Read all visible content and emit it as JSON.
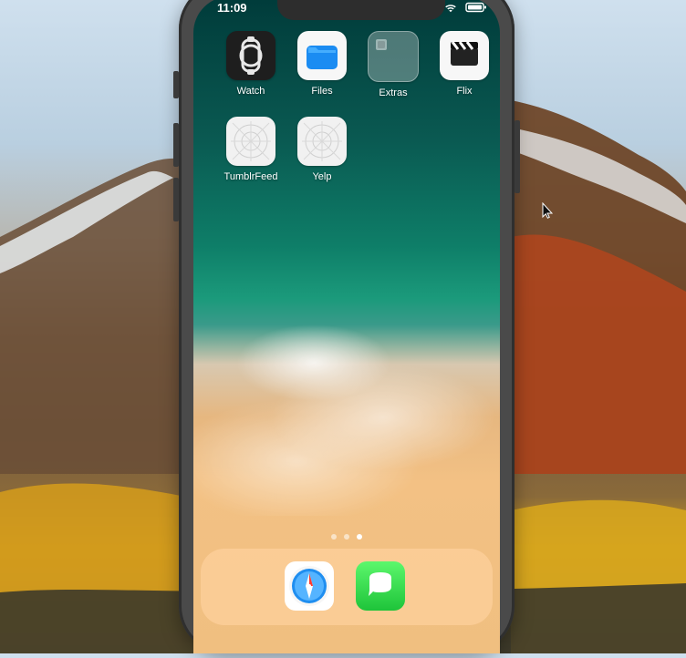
{
  "status_bar": {
    "time": "11:09",
    "icons": [
      "wifi-icon",
      "battery-icon"
    ]
  },
  "home_screen": {
    "apps": [
      {
        "label": "Watch",
        "icon": "watch-icon"
      },
      {
        "label": "Files",
        "icon": "files-icon"
      },
      {
        "label": "Extras",
        "icon": "folder-icon"
      },
      {
        "label": "Flix",
        "icon": "clapperboard-icon"
      },
      {
        "label": "TumblrFeed",
        "icon": "placeholder-app-icon"
      },
      {
        "label": "Yelp",
        "icon": "placeholder-app-icon"
      }
    ],
    "page_indicator": {
      "count": 3,
      "active_index": 2
    },
    "dock": [
      {
        "icon": "safari-icon"
      },
      {
        "icon": "messages-icon"
      }
    ]
  },
  "colors": {
    "phone_frame": "#4a4a4a",
    "text_on_wallpaper": "#ffffff",
    "dock_bg": "rgba(255,210,160,0.65)"
  }
}
